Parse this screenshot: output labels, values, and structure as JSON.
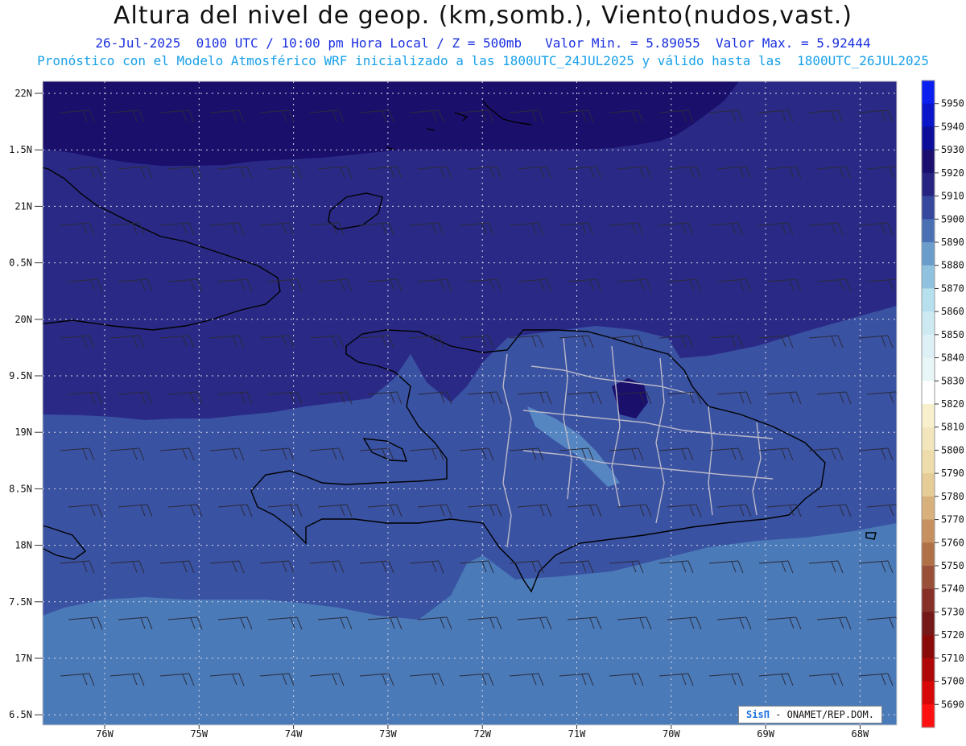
{
  "header": {
    "title": "Altura del nivel de geop. (km,somb.), Viento(nudos,vast.)",
    "line1": "26-Jul-2025  0100 UTC / 10:00 pm Hora Local / Z = 500mb   Valor Min. = 5.89055  Valor Max. = 5.92444",
    "line2": "Pronóstico con el Modelo Atmosférico WRF inicializado a las 1800UTC_24JUL2025 y válido hasta las  1800UTC_26JUL2025"
  },
  "axes": {
    "lat_labels": [
      "22N",
      "1.5N",
      "21N",
      "0.5N",
      "20N",
      "9.5N",
      "19N",
      "8.5N",
      "18N",
      "7.5N",
      "17N",
      "6.5N"
    ],
    "lon_labels": [
      "76W",
      "75W",
      "74W",
      "73W",
      "72W",
      "71W",
      "70W",
      "69W",
      "68W"
    ]
  },
  "colorbar": {
    "levels": [
      "5950",
      "5940",
      "5930",
      "5920",
      "5910",
      "5900",
      "5890",
      "5880",
      "5870",
      "5860",
      "5850",
      "5840",
      "5830",
      "5820",
      "5810",
      "5800",
      "5790",
      "5780",
      "5770",
      "5760",
      "5750",
      "5740",
      "5730",
      "5720",
      "5710",
      "5700",
      "5690"
    ],
    "colors": [
      "#0a1ef0",
      "#0a14c8",
      "#0c0e9a",
      "#1a0f6e",
      "#262480",
      "#35489e",
      "#4a70b4",
      "#6a9ccc",
      "#90c2e0",
      "#b6e0ee",
      "#cdeaf2",
      "#dcf0f6",
      "#e8f6f8",
      "#ffffff",
      "#f8f0cc",
      "#f3e6bc",
      "#eedcaa",
      "#e6cc96",
      "#d8b07c",
      "#c69060",
      "#b07048",
      "#9a5038",
      "#863028",
      "#741818",
      "#8a0a0a",
      "#b00808",
      "#d80808",
      "#ff1010"
    ]
  },
  "credit": {
    "brand": "SisΠ",
    "text": " - ONAMET/REP.DOM."
  }
}
